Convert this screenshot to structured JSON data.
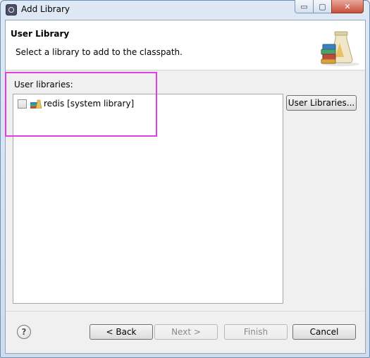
{
  "window": {
    "title": "Add Library",
    "controls": {
      "minimize": "▭",
      "maximize": "▢",
      "close": "✕"
    }
  },
  "header": {
    "title": "User Library",
    "description": "Select a library to add to the classpath."
  },
  "libraries": {
    "label": "User libraries:",
    "items": [
      {
        "label": "redis [system library]",
        "checked": false,
        "icon": "library-jar-icon"
      }
    ]
  },
  "buttons": {
    "user_libraries": "User Libraries...",
    "back": "< Back",
    "next": "Next >",
    "finish": "Finish",
    "cancel": "Cancel",
    "help": "?"
  },
  "colors": {
    "highlight": "#e040e0",
    "disabled_text": "#8a8a8a"
  }
}
